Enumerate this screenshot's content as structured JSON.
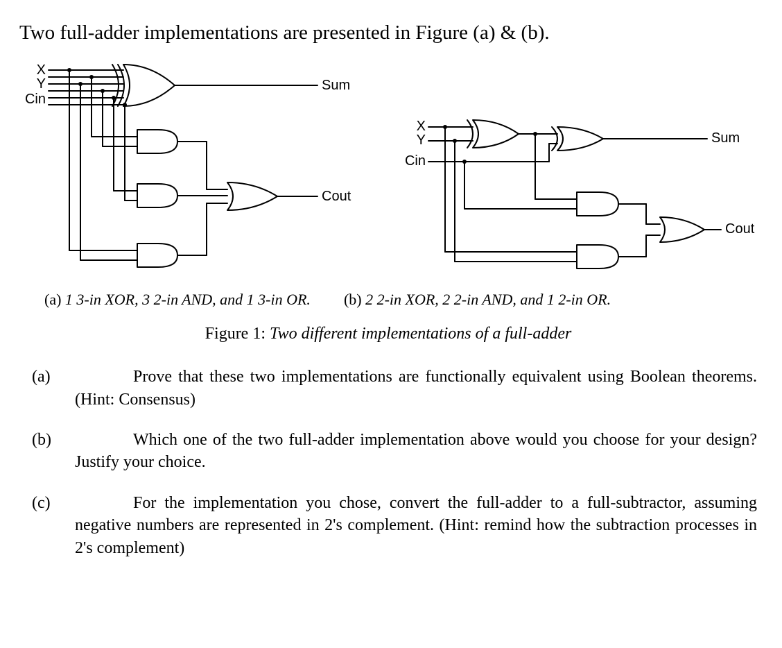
{
  "intro": "Two full-adder implementations are presented in Figure (a) & (b).",
  "circuit_a": {
    "inputs": {
      "x": "X",
      "y": "Y",
      "cin": "Cin"
    },
    "outputs": {
      "sum": "Sum",
      "cout": "Cout"
    },
    "caption_lead": "(a) ",
    "caption_rest": "1 3-in XOR, 3 2-in AND, and 1 3-in OR."
  },
  "circuit_b": {
    "inputs": {
      "x": "X",
      "y": "Y",
      "cin": "Cin"
    },
    "outputs": {
      "sum": "Sum",
      "cout": "Cout"
    },
    "caption_lead": "(b) ",
    "caption_rest": "2 2-in XOR, 2 2-in AND, and 1 2-in OR."
  },
  "figure_caption": {
    "num": "Figure 1: ",
    "text": "Two different implementations of a full-adder"
  },
  "questions": {
    "a": {
      "tag": "(a)",
      "text": "Prove that these two implementations are functionally equivalent using Boolean theorems. (Hint: Consensus)"
    },
    "b": {
      "tag": "(b)",
      "text": "Which one of the two full-adder implementation above would you choose for your design? Justify your choice."
    },
    "c": {
      "tag": "(c)",
      "text": "For the implementation you chose, convert the full-adder to a full-subtractor, assuming negative numbers are represented in 2's complement. (Hint: remind how the subtraction processes in 2's complement)"
    }
  },
  "chart_data": [
    {
      "type": "circuit",
      "name": "full-adder-a",
      "inputs": [
        "X",
        "Y",
        "Cin"
      ],
      "outputs": [
        "Sum",
        "Cout"
      ],
      "gates": [
        {
          "id": "xor1",
          "kind": "XOR",
          "in": 3,
          "inputs": [
            "X",
            "Y",
            "Cin"
          ],
          "output": "Sum"
        },
        {
          "id": "and1",
          "kind": "AND",
          "in": 2,
          "inputs": [
            "X",
            "Y"
          ]
        },
        {
          "id": "and2",
          "kind": "AND",
          "in": 2,
          "inputs": [
            "X",
            "Cin"
          ]
        },
        {
          "id": "and3",
          "kind": "AND",
          "in": 2,
          "inputs": [
            "Y",
            "Cin"
          ]
        },
        {
          "id": "or1",
          "kind": "OR",
          "in": 3,
          "inputs": [
            "and1",
            "and2",
            "and3"
          ],
          "output": "Cout"
        }
      ]
    },
    {
      "type": "circuit",
      "name": "full-adder-b",
      "inputs": [
        "X",
        "Y",
        "Cin"
      ],
      "outputs": [
        "Sum",
        "Cout"
      ],
      "gates": [
        {
          "id": "xor1",
          "kind": "XOR",
          "in": 2,
          "inputs": [
            "X",
            "Y"
          ]
        },
        {
          "id": "xor2",
          "kind": "XOR",
          "in": 2,
          "inputs": [
            "xor1",
            "Cin"
          ],
          "output": "Sum"
        },
        {
          "id": "and1",
          "kind": "AND",
          "in": 2,
          "inputs": [
            "xor1",
            "Cin"
          ]
        },
        {
          "id": "and2",
          "kind": "AND",
          "in": 2,
          "inputs": [
            "X",
            "Y"
          ]
        },
        {
          "id": "or1",
          "kind": "OR",
          "in": 2,
          "inputs": [
            "and1",
            "and2"
          ],
          "output": "Cout"
        }
      ]
    }
  ]
}
